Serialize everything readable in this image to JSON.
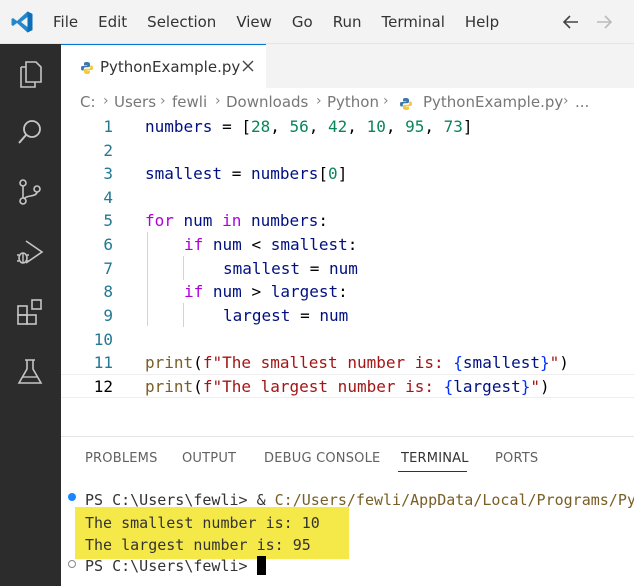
{
  "menu": [
    "File",
    "Edit",
    "Selection",
    "View",
    "Go",
    "Run",
    "Terminal",
    "Help"
  ],
  "tab": {
    "label": "PythonExample.py"
  },
  "breadcrumb": [
    "C:",
    "Users",
    "fewli",
    "Downloads",
    "Python",
    "PythonExample.py",
    "..."
  ],
  "editor": {
    "line_numbers": [
      "1",
      "2",
      "3",
      "4",
      "5",
      "6",
      "7",
      "8",
      "9",
      "10",
      "11",
      "12"
    ],
    "current_line": "12",
    "code": {
      "l1": {
        "a": "numbers",
        "b": " = [",
        "n1": "28",
        "c1": ", ",
        "n2": "56",
        "c2": ", ",
        "n3": "42",
        "c3": ", ",
        "n4": "10",
        "c4": ", ",
        "n5": "95",
        "c5": ", ",
        "n6": "73",
        "end": "]"
      },
      "l3": {
        "a": "smallest",
        "b": " = ",
        "c": "numbers",
        "d": "[",
        "n": "0",
        "e": "]"
      },
      "l5": {
        "kw1": "for",
        "a": " num ",
        "kw2": "in",
        "b": " numbers",
        "c": ":"
      },
      "l6": {
        "kw": "if",
        "a": " num ",
        "op": "<",
        "b": " smallest",
        "c": ":"
      },
      "l7": {
        "a": "smallest",
        "b": " = ",
        "c": "num"
      },
      "l8": {
        "kw": "if",
        "a": " num ",
        "op": ">",
        "b": " largest",
        "c": ":"
      },
      "l9": {
        "a": "largest",
        "b": " = ",
        "c": "num"
      },
      "l11": {
        "fn": "print",
        "p": "(",
        "f": "f",
        "s1": "\"The smallest number is: ",
        "br1": "{",
        "v": "smallest",
        "br2": "}",
        "s2": "\"",
        "pe": ")"
      },
      "l12": {
        "fn": "print",
        "p": "(",
        "f": "f",
        "s1": "\"The largest number is: ",
        "br1": "{",
        "v": "largest",
        "br2": "}",
        "s2": "\"",
        "pe": ")"
      }
    }
  },
  "panel": {
    "tabs": [
      "PROBLEMS",
      "OUTPUT",
      "DEBUG CONSOLE",
      "TERMINAL",
      "PORTS"
    ],
    "active_tab": "TERMINAL",
    "terminal": {
      "prompt1": "PS C:\\Users\\fewli> ",
      "cmd_amp": "& ",
      "cmd_path": "C:/Users/fewli/AppData/Local/Programs/Py",
      "out1": "The smallest number is: 10",
      "out2": "The largest number is: 95",
      "prompt2": "PS C:\\Users\\fewli> "
    }
  },
  "colors": {
    "accent": "#0078d4",
    "activity_bar": "#2c2c2c",
    "highlight": "#f5e94a"
  },
  "icons": [
    "vscode-logo-icon",
    "arrow-left-icon",
    "arrow-right-icon",
    "explorer-icon",
    "search-icon",
    "source-control-icon",
    "run-debug-icon",
    "extensions-icon",
    "testing-icon",
    "python-file-icon",
    "close-icon"
  ]
}
